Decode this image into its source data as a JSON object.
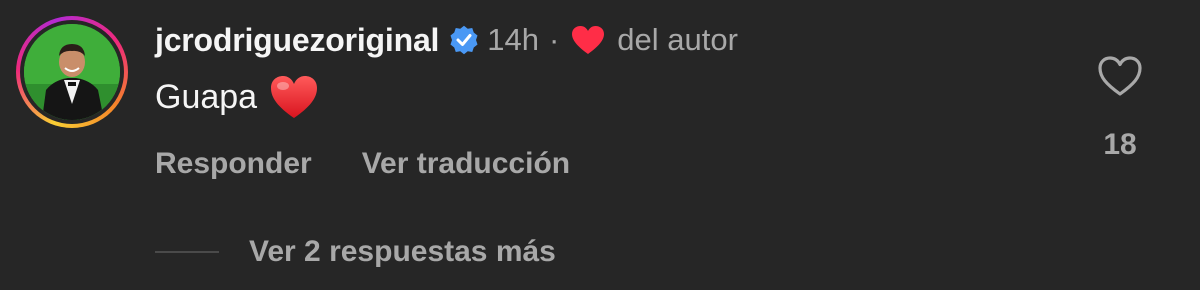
{
  "comment": {
    "username": "jcrodriguezoriginal",
    "verified": true,
    "time": "14h",
    "separator": "·",
    "author_label": "del autor",
    "text": "Guapa",
    "like_count": "18",
    "actions": {
      "reply": "Responder",
      "translate": "Ver traducción"
    },
    "replies_link": "Ver 2 respuestas más"
  },
  "icons": {
    "verified": "verified-badge-icon",
    "author_like": "heart-filled-icon",
    "emoji": "red-heart-emoji",
    "like": "heart-outline-icon"
  },
  "colors": {
    "background": "#262626",
    "primary_text": "#f5f5f5",
    "secondary_text": "#a8a8a8",
    "verified_blue": "#4a98f4",
    "heart_red": "#ff2d47"
  }
}
